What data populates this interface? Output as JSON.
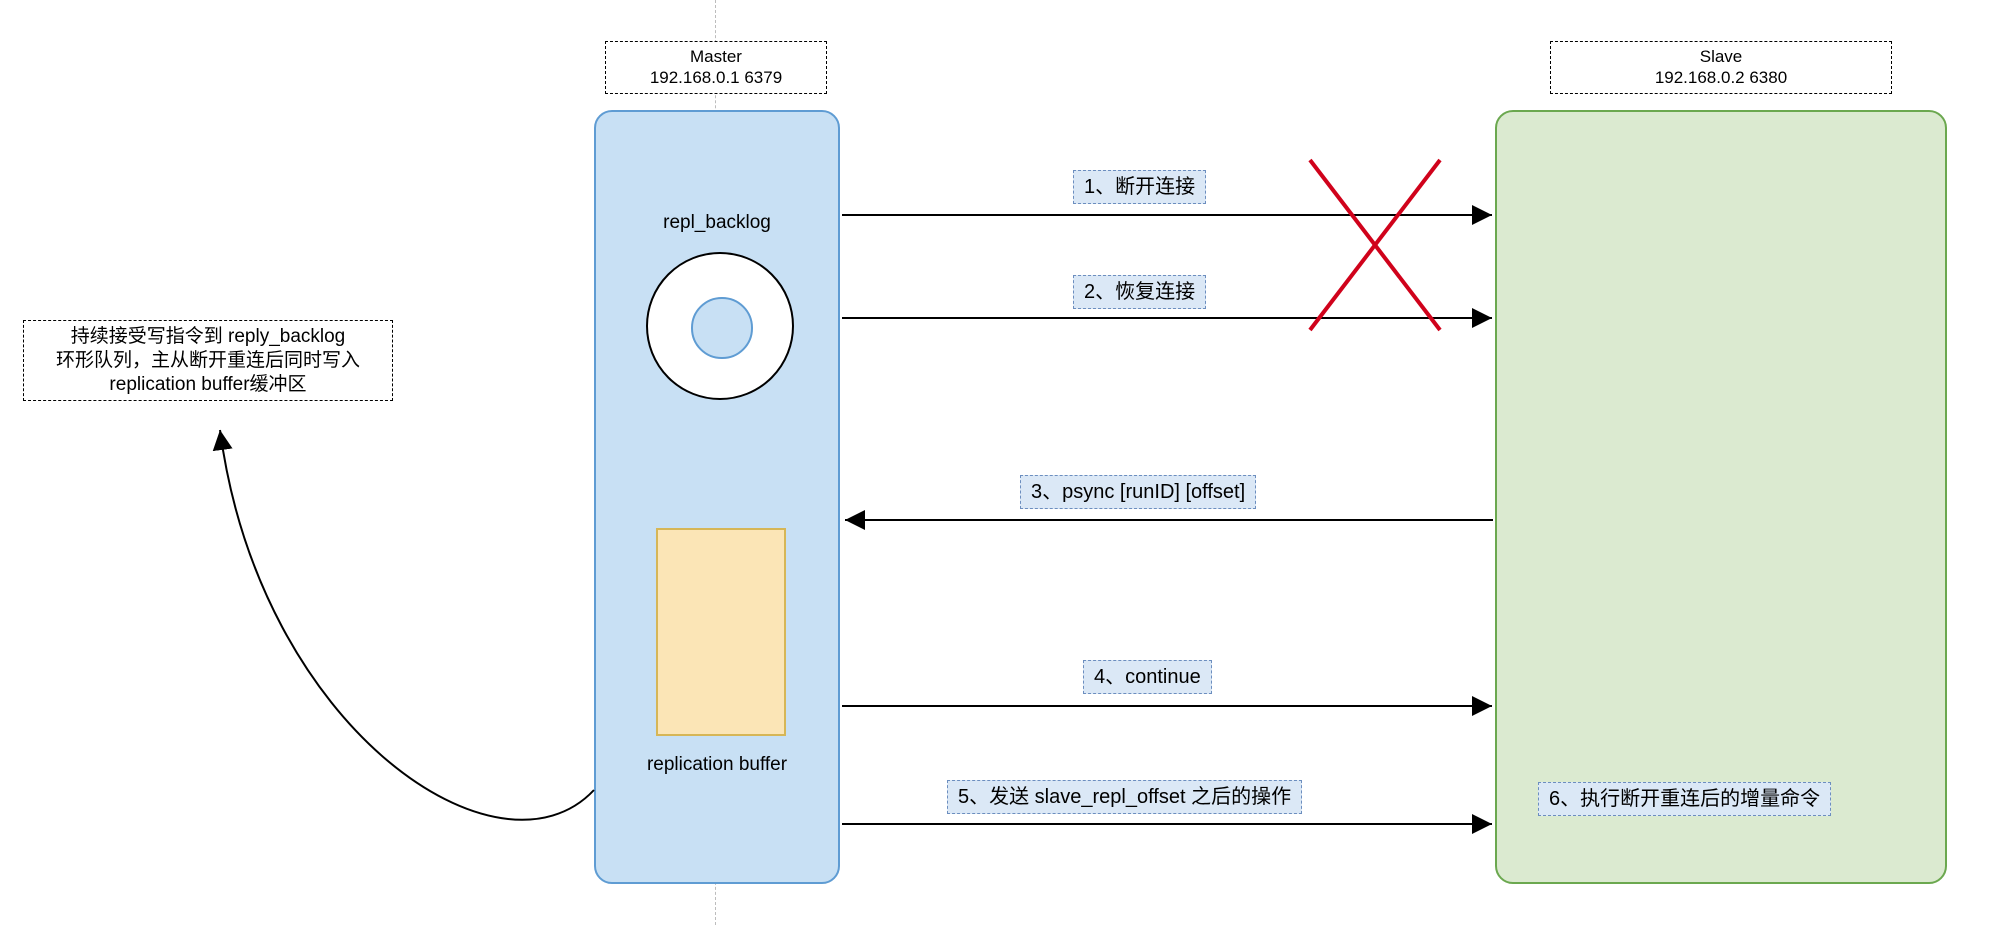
{
  "master": {
    "title": "Master",
    "address": "192.168.0.1  6379",
    "backlog_label": "repl_backlog",
    "buffer_label": "replication buffer"
  },
  "slave": {
    "title": "Slave",
    "address": "192.168.0.2  6380"
  },
  "side_note": {
    "line1": "持续接受写指令到 reply_backlog",
    "line2": "环形队列，主从断开重连后同时写入",
    "line3": "replication buffer缓冲区"
  },
  "steps": {
    "s1": "1、断开连接",
    "s2": "2、恢复连接",
    "s3": "3、psync [runID] [offset]",
    "s4": "4、continue",
    "s5": "5、发送 slave_repl_offset 之后的操作",
    "s6": "6、执行断开重连后的增量命令"
  }
}
